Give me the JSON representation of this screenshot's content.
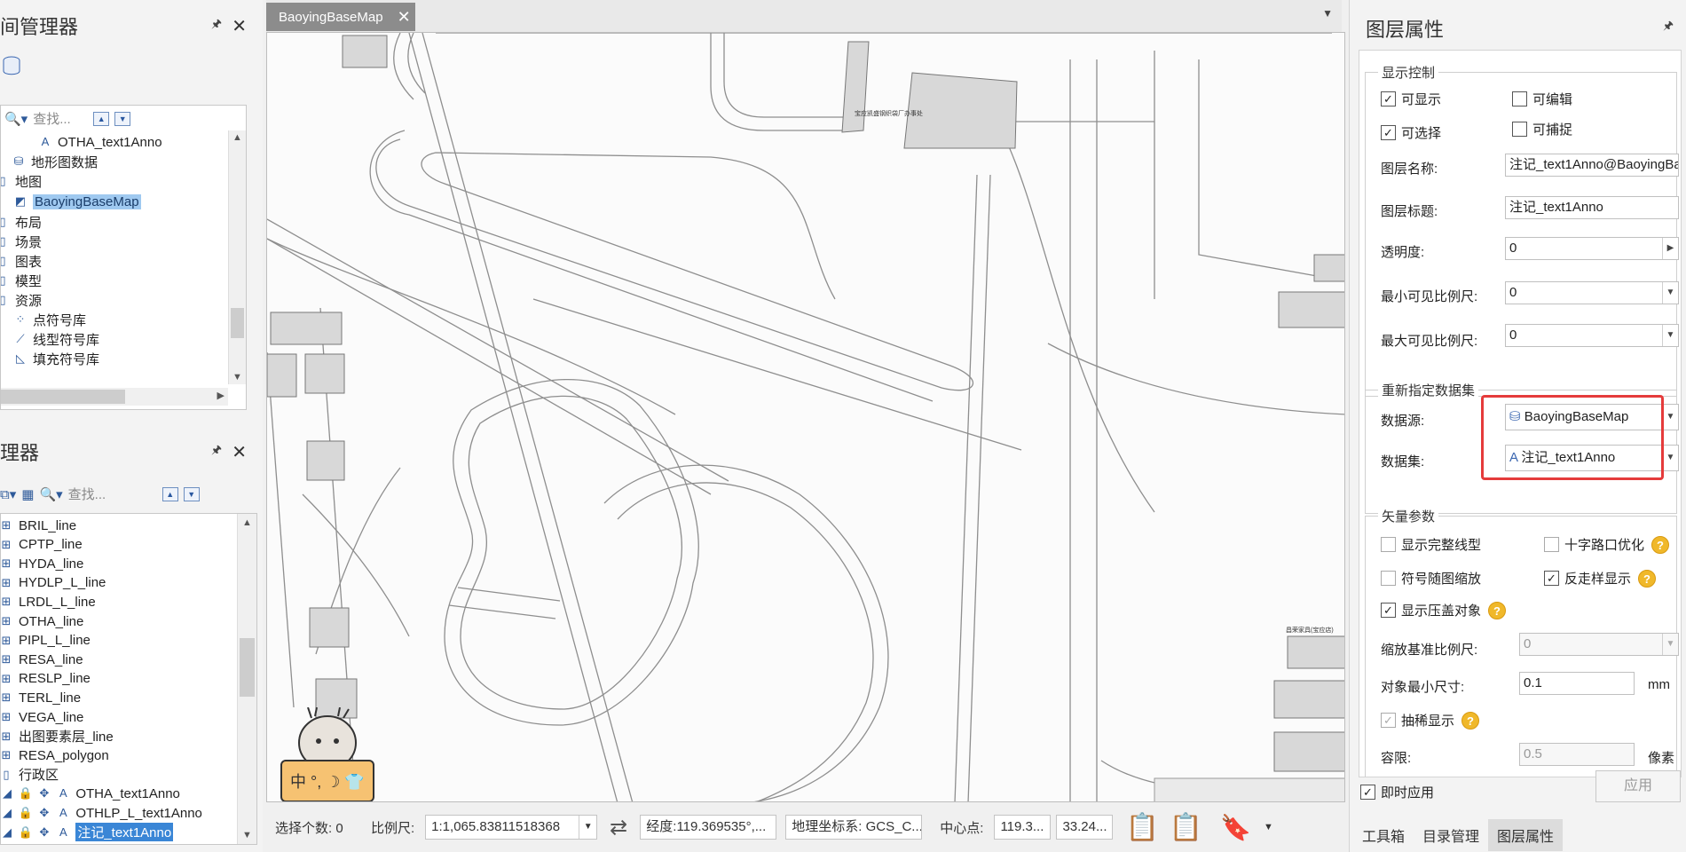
{
  "left_top": {
    "title": "间管理器",
    "search_placeholder": "查找...",
    "items": [
      "OTHA_text1Anno",
      "地形图数据",
      "地图",
      "BaoyingBaseMap",
      "布局",
      "场景",
      "图表",
      "模型",
      "资源",
      "点符号库",
      "线型符号库",
      "填充符号库"
    ]
  },
  "left_bottom": {
    "title": "理器",
    "search_placeholder": "查找...",
    "items": [
      "BRIL_line",
      "CPTP_line",
      "HYDA_line",
      "HYDLP_L_line",
      "LRDL_L_line",
      "OTHA_line",
      "PIPL_L_line",
      "RESA_line",
      "RESLP_line",
      "TERL_line",
      "VEGA_line",
      "出图要素层_line",
      "RESA_polygon",
      "行政区",
      "OTHA_text1Anno",
      "OTHLP_L_text1Anno",
      "注记_text1Anno"
    ]
  },
  "tab": {
    "label": "BaoyingBaseMap"
  },
  "map": {
    "labels": [
      "宝应凯盛钢织袋厂办事处",
      "昌荣家具(宝应店)"
    ],
    "sticker_text": "中 °, ☽ 👕"
  },
  "status": {
    "selected_count_label": "选择个数: 0",
    "scale_label": "比例尺:",
    "scale_value": "1:1,065.83811518368",
    "longitude": "经度:119.369535°,...",
    "crs": "地理坐标系: GCS_C...",
    "center_label": "中心点:",
    "center_x": "119.3...",
    "center_y": "33.24..."
  },
  "props": {
    "title": "图层属性",
    "display_group": "显示控制",
    "visible": "可显示",
    "editable": "可编辑",
    "selectable": "可选择",
    "snappable": "可捕捉",
    "layer_name_label": "图层名称:",
    "layer_name_value": "注记_text1Anno@BaoyingBa",
    "layer_caption_label": "图层标题:",
    "layer_caption_value": "注记_text1Anno",
    "opacity_label": "透明度:",
    "opacity_value": "0",
    "min_scale_label": "最小可见比例尺:",
    "min_scale_value": "0",
    "max_scale_label": "最大可见比例尺:",
    "max_scale_value": "0",
    "dataset_group": "重新指定数据集",
    "datasource_label": "数据源:",
    "datasource_value": "BaoyingBaseMap",
    "dataset_label": "数据集:",
    "dataset_value": "注记_text1Anno",
    "vector_group": "矢量参数",
    "full_linetype": "显示完整线型",
    "crossroad_opt": "十字路口优化",
    "symbol_scale": "符号随图缩放",
    "antialias": "反走样显示",
    "show_overlap": "显示压盖对象",
    "scale_base_label": "缩放基准比例尺:",
    "scale_base_value": "0",
    "min_size_label": "对象最小尺寸:",
    "min_size_value": "0.1",
    "min_size_unit": "mm",
    "thin_display": "抽稀显示",
    "tolerance_label": "容限:",
    "tolerance_value": "0.5",
    "tolerance_unit": "像素",
    "instant_apply": "即时应用",
    "apply_btn": "应用"
  },
  "bottom_tabs": [
    "工具箱",
    "目录管理",
    "图层属性"
  ]
}
